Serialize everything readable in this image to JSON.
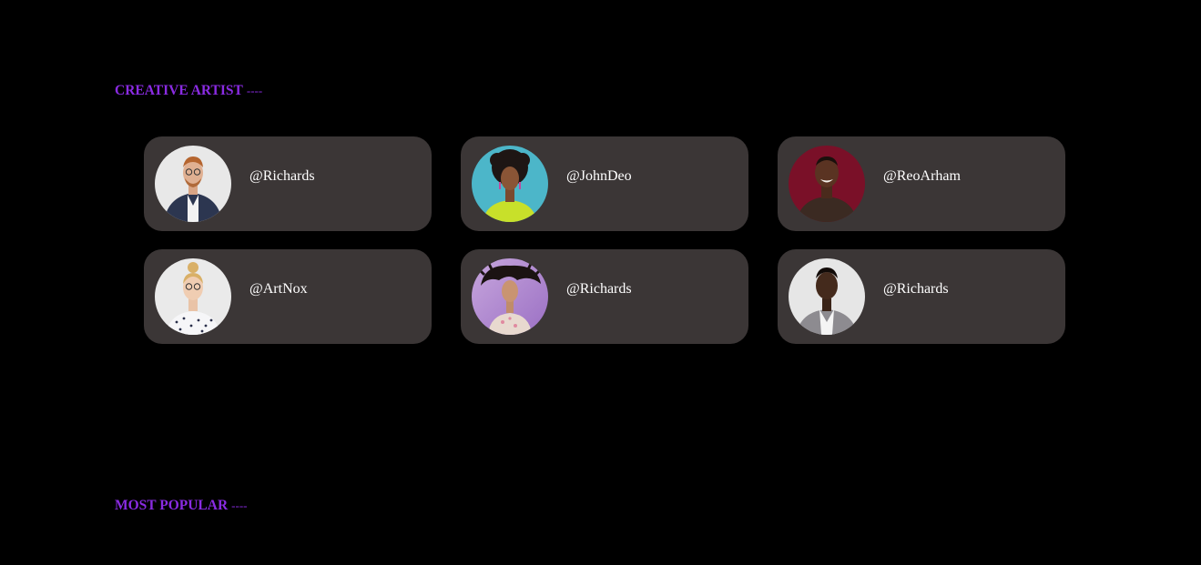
{
  "sections": {
    "creative": {
      "title": "CREATIVE ARTIST",
      "dash": "----"
    },
    "popular": {
      "title": "MOST POPULAR",
      "dash": "----"
    }
  },
  "colors": {
    "background": "#000000",
    "accent": "#8a2be2",
    "card": "#3b3636",
    "text": "#ffffff"
  },
  "artists": [
    {
      "handle": "@Richards",
      "avatar": "avatar-man-glasses-jacket"
    },
    {
      "handle": "@JohnDeo",
      "avatar": "avatar-woman-curly-hair-teal"
    },
    {
      "handle": "@ReoArham",
      "avatar": "avatar-man-smiling-red"
    },
    {
      "handle": "@ArtNox",
      "avatar": "avatar-woman-glasses-bun"
    },
    {
      "handle": "@Richards",
      "avatar": "avatar-woman-hair-flip-purple"
    },
    {
      "handle": "@Richards",
      "avatar": "avatar-man-suit-grey"
    }
  ]
}
